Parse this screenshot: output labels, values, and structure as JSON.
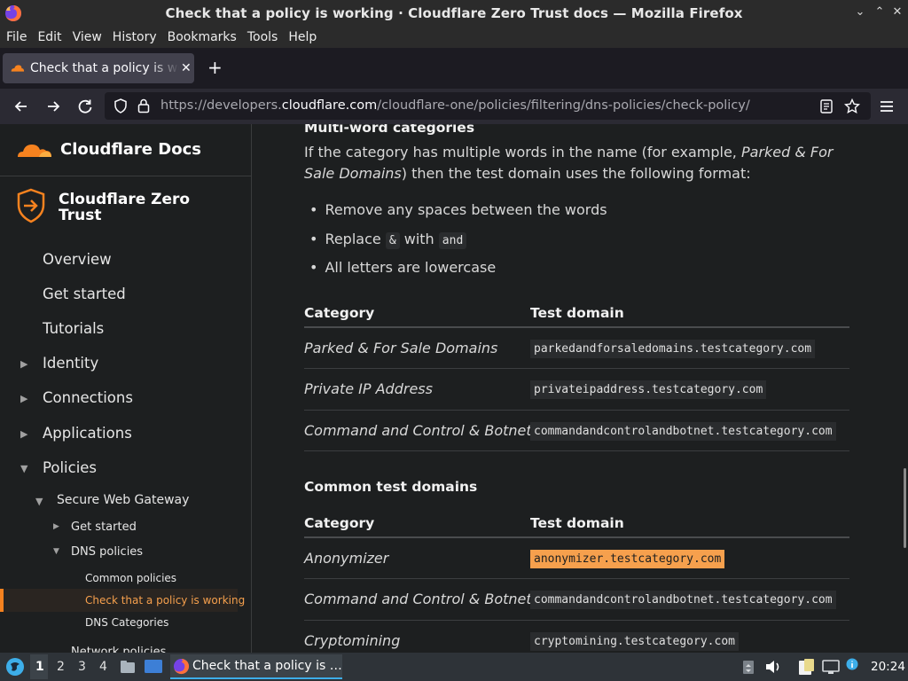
{
  "window": {
    "title": "Check that a policy is working · Cloudflare Zero Trust docs — Mozilla Firefox",
    "controls": [
      "⌄",
      "⌃",
      "✕"
    ]
  },
  "menu": [
    "File",
    "Edit",
    "View",
    "History",
    "Bookmarks",
    "Tools",
    "Help"
  ],
  "tab": {
    "label": "Check that a policy is working",
    "close": "✕",
    "new_tab": "+"
  },
  "url": {
    "prefix": "https://developers.",
    "host": "cloudflare.com",
    "path": "/cloudflare-one/policies/filtering/dns-policies/check-policy/"
  },
  "sidebar": {
    "brand": "Cloudflare Docs",
    "product": "Cloudflare Zero Trust",
    "items": [
      "Overview",
      "Get started",
      "Tutorials",
      "Identity",
      "Connections",
      "Applications",
      "Policies"
    ],
    "arrows": {
      "collapsed": "▶",
      "expanded": "▼"
    },
    "swg": "Secure Web Gateway",
    "swg_children": [
      "Get started",
      "DNS policies"
    ],
    "dns_children": [
      "Common policies",
      "Check that a policy is working",
      "DNS Categories"
    ],
    "next_partial": "Network policies",
    "accent": "#f6821f"
  },
  "content": {
    "heading_multiword": "Multi-word categories",
    "para_start": "If the category has multiple words in the name (for example, ",
    "para_example": "Parked & For Sale Domains",
    "para_end": ") then the test domain uses the following format:",
    "bullet_dot": "•",
    "bullets": {
      "b1": "Remove any spaces between the words",
      "b2_pre": "Replace",
      "b2_code1": "&",
      "b2_mid": "with",
      "b2_code2": "and",
      "b3": "All letters are lowercase"
    },
    "table_headers": {
      "category": "Category",
      "domain": "Test domain"
    },
    "table1": [
      {
        "category": "Parked & For Sale Domains",
        "domain": "parkedandforsaledomains.testcategory.com"
      },
      {
        "category": "Private IP Address",
        "domain": "privateipaddress.testcategory.com"
      },
      {
        "category": "Command and Control & Botnet",
        "domain": "commandandcontrolandbotnet.testcategory.com"
      }
    ],
    "heading_common": "Common test domains",
    "table2": [
      {
        "category": "Anonymizer",
        "domain": "anonymizer.testcategory.com"
      },
      {
        "category": "Command and Control & Botnet",
        "domain": "commandandcontrolandbotnet.testcategory.com"
      },
      {
        "category": "Cryptomining",
        "domain": "cryptomining.testcategory.com"
      }
    ]
  },
  "taskbar": {
    "workspaces": [
      "1",
      "2",
      "3",
      "4"
    ],
    "task_label": "Check that a policy is …",
    "time": "20:24"
  }
}
